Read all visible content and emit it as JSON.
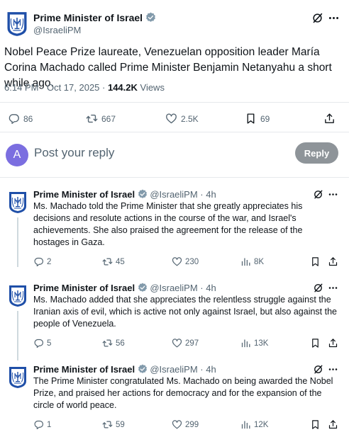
{
  "main_tweet": {
    "name": "Prime Minister of Israel",
    "handle": "@IsraeliPM",
    "text": "Nobel Peace Prize laureate, Venezuelan opposition leader María Corina Machado called Prime Minister Benjamin Netanyahu a short while ago.",
    "time": "6:14 PM · Oct 17, 2025 · ",
    "views_count": "144.2K",
    "views_label": " Views",
    "stats": {
      "replies": "86",
      "reposts": "667",
      "likes": "2.5K",
      "bookmarks": "69"
    }
  },
  "reply_box": {
    "avatar_letter": "A",
    "placeholder": "Post your reply",
    "button": "Reply",
    "avatar_color": "#7b6ee0"
  },
  "replies": [
    {
      "name": "Prime Minister of Israel",
      "handle": "@IsraeliPM",
      "age": " · 4h",
      "text": "Ms. Machado told the Prime Minister that she greatly appreciates his decisions and resolute actions in the course of the war, and Israel's achievements. She also praised the agreement for the release of the hostages in Gaza.",
      "replies": "2",
      "reposts": "45",
      "likes": "230",
      "views": "8K"
    },
    {
      "name": "Prime Minister of Israel",
      "handle": "@IsraeliPM",
      "age": " · 4h",
      "text": "Ms. Machado added that she appreciates the relentless struggle against the Iranian axis of evil, which is active not only against Israel, but also against the people of Venezuela.",
      "replies": "5",
      "reposts": "56",
      "likes": "297",
      "views": "13K"
    },
    {
      "name": "Prime Minister of Israel",
      "handle": "@IsraeliPM",
      "age": " · 4h",
      "text": "The Prime Minister congratulated Ms. Machado on being awarded the Nobel Prize, and praised her actions for democracy and for the expansion of the circle of world peace.",
      "replies": "1",
      "reposts": "59",
      "likes": "299",
      "views": "12K"
    }
  ],
  "icons": {
    "avatar": "israel-emblem-icon",
    "verified": "verified-badge-icon",
    "grok": "grok-icon",
    "more": "more-icon",
    "reply": "reply-icon",
    "repost": "repost-icon",
    "like": "like-icon",
    "views": "views-icon",
    "bookmark": "bookmark-icon",
    "share": "share-icon"
  },
  "colors": {
    "text": "#0f1419",
    "secondary": "#536471",
    "divider": "#e6e9ec",
    "verified": "#829aab",
    "emblem_blue": "#1f4fa8",
    "reply_button": "#8e9499"
  }
}
